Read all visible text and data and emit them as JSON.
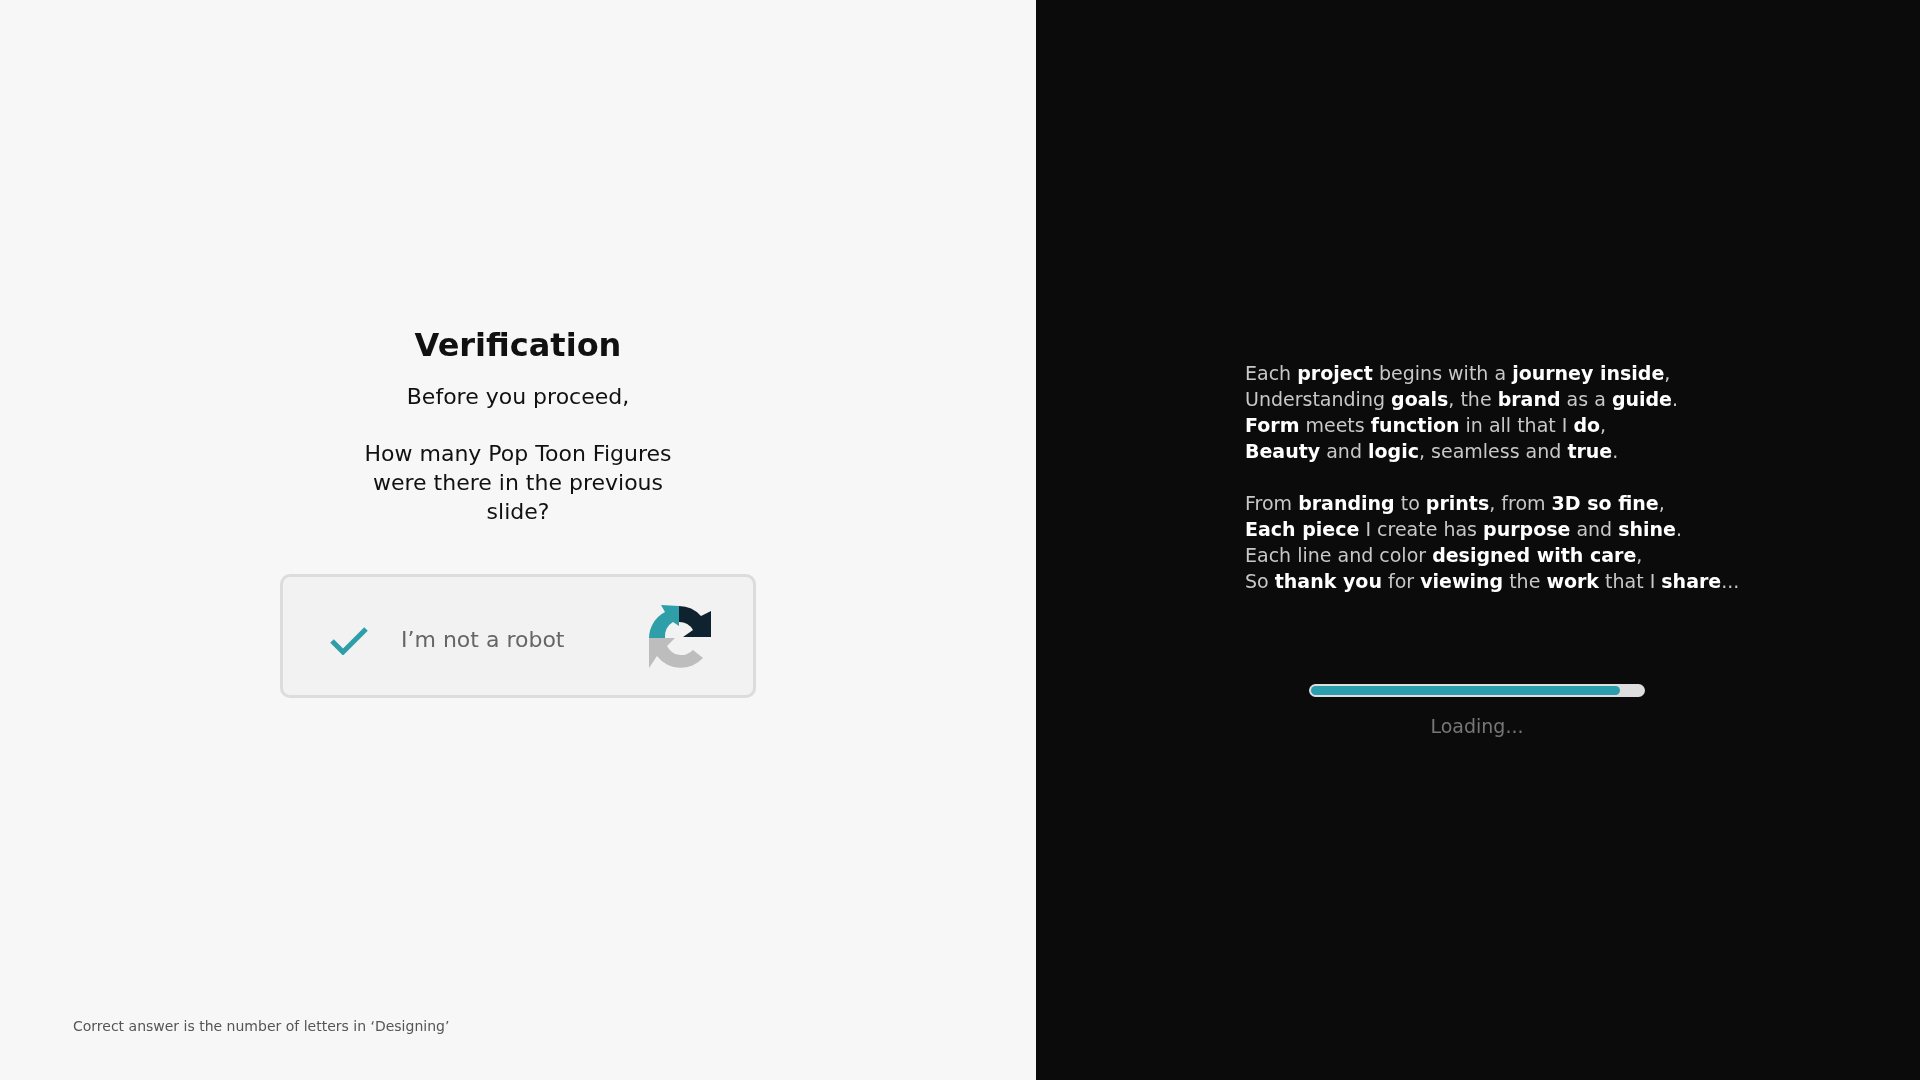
{
  "verification": {
    "title": "Verification",
    "subtitle": "Before you proceed,",
    "question": "How many Pop Toon Figures were there in the previous slide?"
  },
  "captcha": {
    "label": "I’m not a robot",
    "checked": true
  },
  "hint": "Correct answer is the number of letters in ‘Designing’",
  "poem": [
    [
      "Each **project** begins with a **journey inside**,",
      "Understanding **goals**, the **brand** as a **guide**.",
      "**Form** meets **function** in all that I **do**,",
      "**Beauty** and **logic**, seamless and **true**."
    ],
    [
      "From **branding** to **prints**, from **3D so fine**,",
      "**Each piece** I create has **purpose** and **shine**.",
      "Each line and color **designed with care**,",
      "So **thank you** for **viewing** the **work** that I **share**..."
    ]
  ],
  "progress": {
    "level": 0.93,
    "label": "Loading..."
  }
}
